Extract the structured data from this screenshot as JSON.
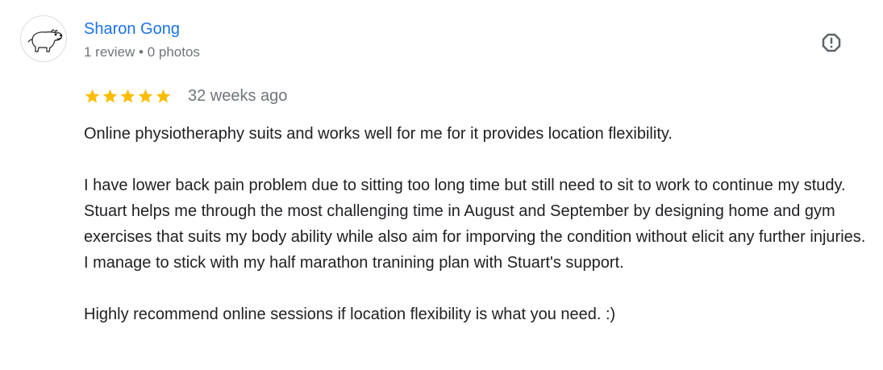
{
  "reviewer": {
    "name": "Sharon Gong",
    "meta": "1 review • 0 photos",
    "avatar_icon": "hippo-avatar-icon"
  },
  "report": {
    "icon": "report-flag-icon"
  },
  "rating": {
    "stars": 5,
    "max_stars": 5,
    "star_color": "#fbbc04",
    "date": "32 weeks ago"
  },
  "review": {
    "paragraphs": [
      "Online physiotheraphy suits and works well for me for it provides location flexibility.",
      "I have lower back pain problem due to sitting too long time but still need to sit to work to continue my study. Stuart helps me through the most challenging time in August and September by designing home and gym exercises that suits my body ability while also aim for imporving the condition without elicit any further injuries. I manage to stick with my half marathon tranining plan with Stuart's support.",
      "Highly recommend online sessions if location flexibility is what you need. :)"
    ]
  },
  "colors": {
    "link": "#1a73e8",
    "secondary_text": "#70757a",
    "body_text": "#202124",
    "icon": "#5f6368"
  }
}
